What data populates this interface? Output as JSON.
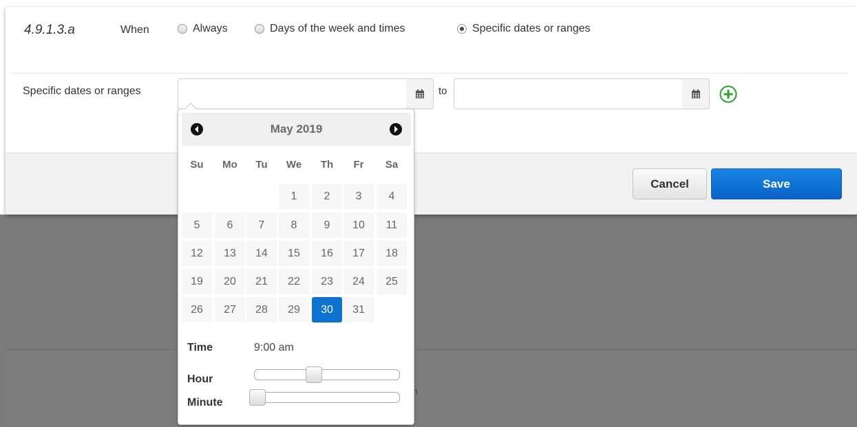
{
  "step": {
    "number": "4.9.1.3.a",
    "when_label": "When"
  },
  "schedule_options": [
    {
      "label": "Always",
      "checked": false
    },
    {
      "label": "Days of the week and times",
      "checked": false
    },
    {
      "label": "Specific dates or ranges",
      "checked": true
    }
  ],
  "range_row": {
    "label": "Specific dates or ranges",
    "start_value": "",
    "end_value": "",
    "to_label": "to"
  },
  "footer": {
    "cancel_label": "Cancel",
    "save_label": "Save"
  },
  "background": {
    "partial_text": "n"
  },
  "datepicker": {
    "month_title": "May 2019",
    "weekdays": [
      "Su",
      "Mo",
      "Tu",
      "We",
      "Th",
      "Fr",
      "Sa"
    ],
    "weeks": [
      [
        "",
        "",
        "",
        "1",
        "2",
        "3",
        "4"
      ],
      [
        "5",
        "6",
        "7",
        "8",
        "9",
        "10",
        "11"
      ],
      [
        "12",
        "13",
        "14",
        "15",
        "16",
        "17",
        "18"
      ],
      [
        "19",
        "20",
        "21",
        "22",
        "23",
        "24",
        "25"
      ],
      [
        "26",
        "27",
        "28",
        "29",
        "30",
        "31",
        ""
      ]
    ],
    "selected_day": "30",
    "time_label": "Time",
    "time_value": "9:00 am",
    "hour_label": "Hour",
    "minute_label": "Minute",
    "hour_value": 9,
    "hour_max": 23,
    "minute_value": 0,
    "minute_max": 59
  },
  "colors": {
    "accent": "#0e72cf",
    "add_icon": "#2ca02c",
    "backdrop": "#7a7a7a"
  },
  "icons": {
    "calendar": "calendar-icon",
    "add": "plus-circle-icon",
    "prev": "chevron-left-circle-icon",
    "next": "chevron-right-circle-icon"
  }
}
